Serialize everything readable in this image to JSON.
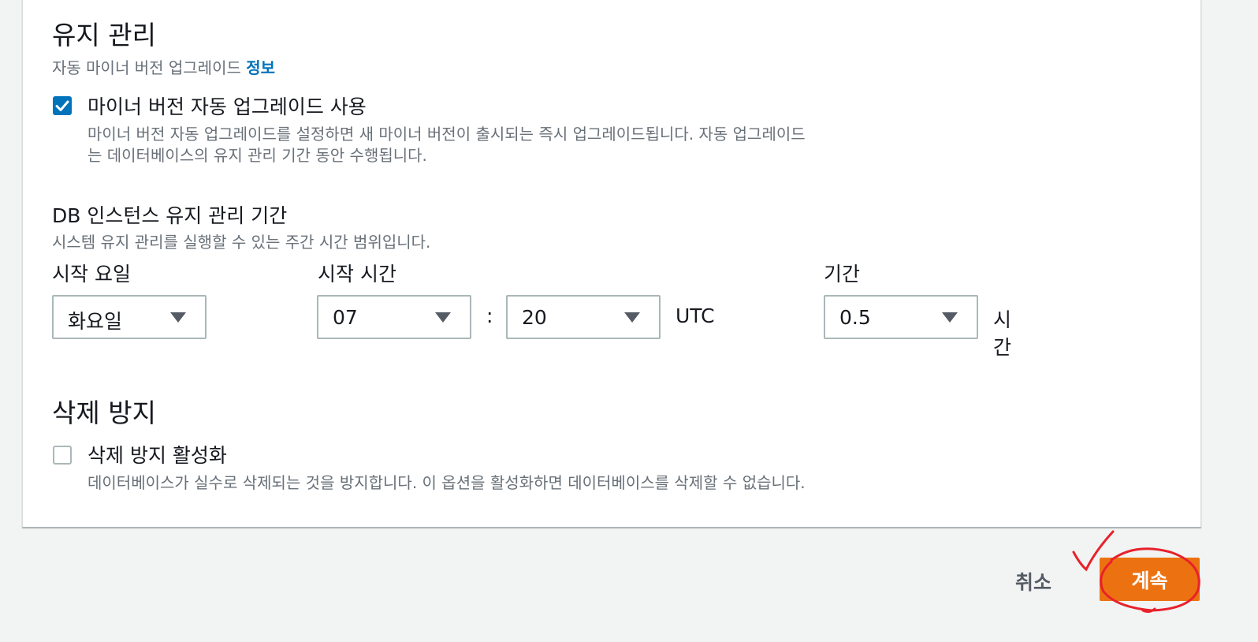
{
  "maintenance": {
    "title": "유지 관리",
    "subtitle": "자동 마이너 버전 업그레이드",
    "info_link": "정보",
    "auto_upgrade": {
      "checked": true,
      "label": "마이너 버전 자동 업그레이드 사용",
      "desc_line1": "마이너 버전 자동 업그레이드를 설정하면 새 마이너 버전이 출시되는 즉시 업그레이드됩니다. 자동 업그레이드",
      "desc_line2": "는 데이터베이스의 유지 관리 기간 동안 수행됩니다."
    },
    "window": {
      "title": "DB 인스턴스 유지 관리 기간",
      "desc": "시스템 유지 관리를 실행할 수 있는 주간 시간 범위입니다.",
      "start_day_label": "시작 요일",
      "start_day_value": "화요일",
      "start_time_label": "시작 시간",
      "hour_value": "07",
      "separator": ":",
      "minute_value": "20",
      "timezone": "UTC",
      "duration_label": "기간",
      "duration_value": "0.5",
      "duration_unit_line1": "시",
      "duration_unit_line2": "간"
    }
  },
  "deletion_protection": {
    "title": "삭제 방지",
    "checked": false,
    "label": "삭제 방지 활성화",
    "desc": "데이터베이스가 실수로 삭제되는 것을 방지합니다. 이 옵션을 활성화하면 데이터베이스를 삭제할 수 없습니다."
  },
  "actions": {
    "cancel": "취소",
    "continue": "계속"
  },
  "colors": {
    "primary_button": "#ec7211",
    "link": "#0073bb",
    "checkbox_checked": "#0073bb",
    "annotation": "#e8212b"
  }
}
